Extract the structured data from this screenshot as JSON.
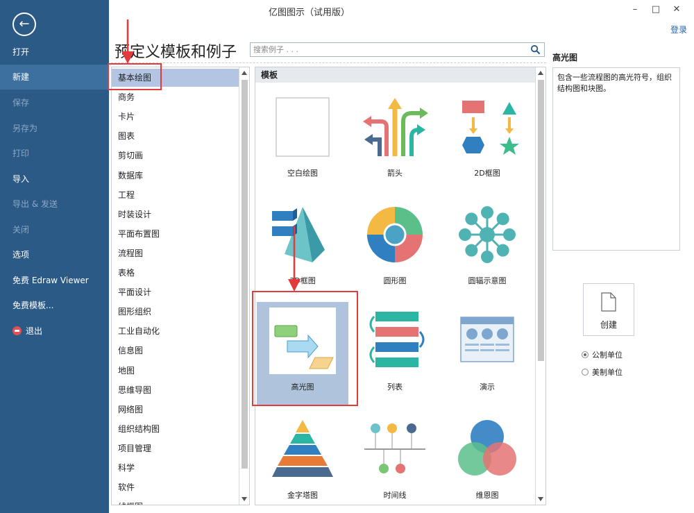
{
  "window": {
    "title": "亿图图示（试用版）",
    "login": "登录"
  },
  "nav": {
    "items": [
      {
        "label": "打开",
        "state": "normal"
      },
      {
        "label": "新建",
        "state": "active"
      },
      {
        "label": "保存",
        "state": "disabled"
      },
      {
        "label": "另存为",
        "state": "disabled"
      },
      {
        "label": "打印",
        "state": "disabled"
      },
      {
        "label": "导入",
        "state": "normal"
      },
      {
        "label": "导出 & 发送",
        "state": "disabled"
      },
      {
        "label": "关闭",
        "state": "disabled"
      },
      {
        "label": "选项",
        "state": "normal"
      },
      {
        "label": "免费 Edraw Viewer",
        "state": "normal"
      },
      {
        "label": "免费模板...",
        "state": "normal"
      },
      {
        "label": "退出",
        "state": "normal"
      }
    ]
  },
  "main": {
    "heading": "预定义模板和例子",
    "search_placeholder": "搜索例子 . . ."
  },
  "categories": [
    "基本绘图",
    "商务",
    "卡片",
    "图表",
    "剪切画",
    "数据库",
    "工程",
    "时装设计",
    "平面布置图",
    "流程图",
    "表格",
    "平面设计",
    "图形组织",
    "工业自动化",
    "信息图",
    "地图",
    "思维导图",
    "网络图",
    "组织结构图",
    "项目管理",
    "科学",
    "软件",
    "线框图"
  ],
  "gallery": {
    "header": "模板",
    "tiles": [
      {
        "label": "空白绘图",
        "icon": "blank-page-icon"
      },
      {
        "label": "箭头",
        "icon": "arrows-icon"
      },
      {
        "label": "2D框图",
        "icon": "block-2d-icon"
      },
      {
        "label": "3D框图",
        "icon": "block-3d-icon"
      },
      {
        "label": "圆形图",
        "icon": "circle-chart-icon"
      },
      {
        "label": "圆辐示意图",
        "icon": "radial-diagram-icon"
      },
      {
        "label": "高光图",
        "icon": "highlight-diagram-icon"
      },
      {
        "label": "列表",
        "icon": "list-icon"
      },
      {
        "label": "演示",
        "icon": "presentation-icon"
      },
      {
        "label": "金字塔图",
        "icon": "pyramid-icon"
      },
      {
        "label": "时间线",
        "icon": "timeline-icon"
      },
      {
        "label": "维恩图",
        "icon": "venn-icon"
      }
    ]
  },
  "preview": {
    "title": "高光图",
    "description": "包含一些流程图的高光符号，组织结构图和块图。",
    "create_label": "创建",
    "units": [
      {
        "label": "公制单位",
        "checked": true
      },
      {
        "label": "美制单位",
        "checked": false
      }
    ]
  },
  "colors": {
    "nav_bg": "#2b5a87",
    "selected": "#b3c5e3",
    "annotation": "#e23b3b",
    "accent_link": "#2563b0"
  }
}
